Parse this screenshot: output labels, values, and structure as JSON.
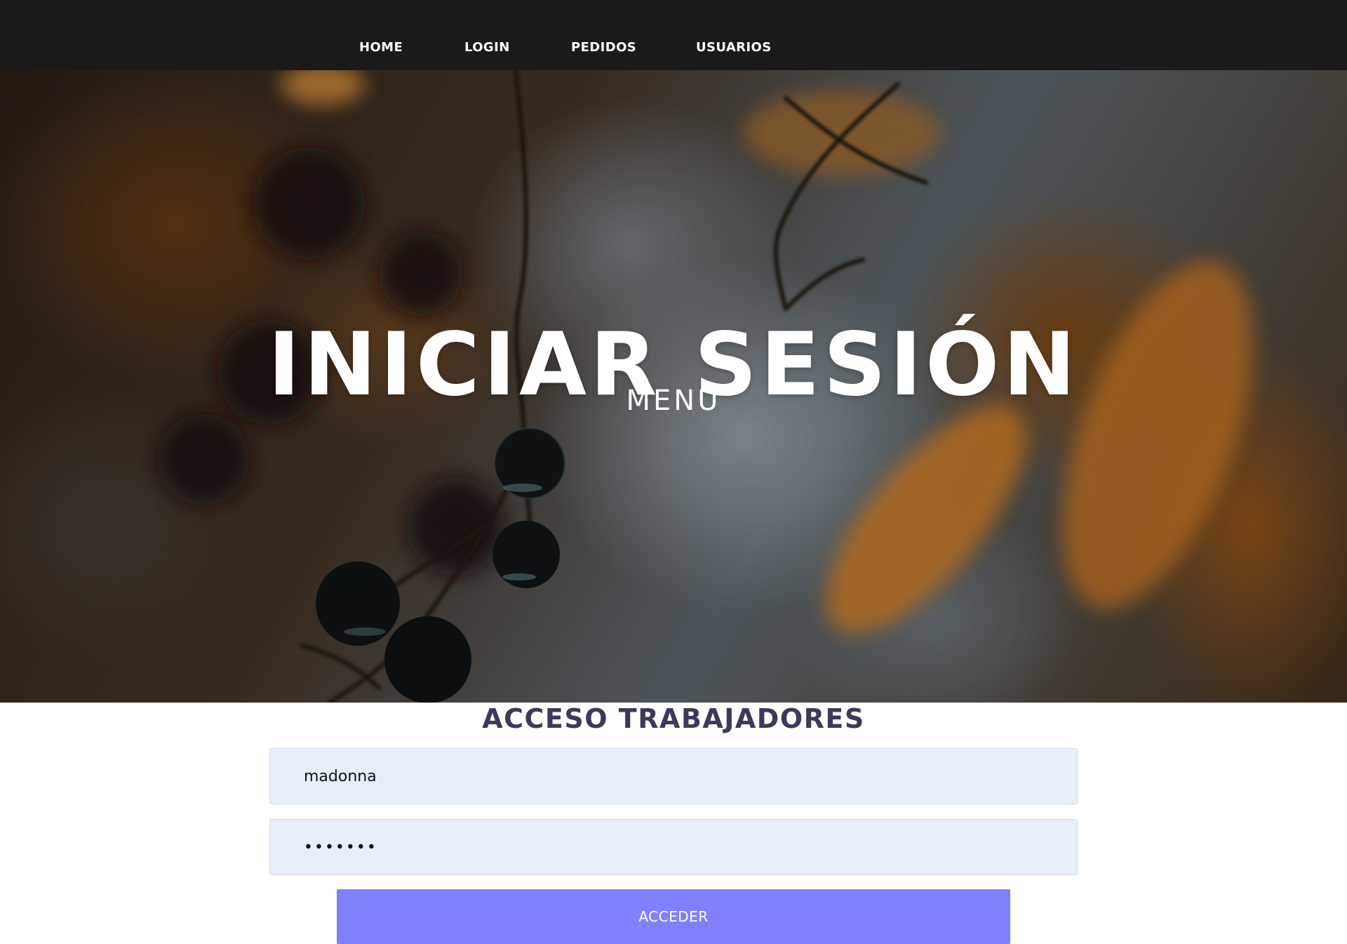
{
  "nav": {
    "items": [
      {
        "label": "HOME"
      },
      {
        "label": "LOGIN"
      },
      {
        "label": "PEDIDOS"
      },
      {
        "label": "USUARIOS"
      }
    ]
  },
  "hero": {
    "title": "INICIAR SESIÓN",
    "subtitle": "MENÚ"
  },
  "login": {
    "heading": "ACCESO TRABAJADORES",
    "username_value": "madonna",
    "password_value": "•••••••",
    "submit_label": "ACCEDER"
  },
  "colors": {
    "navbar_bg": "#1b1a1b",
    "input_bg": "#e8effa",
    "button_bg": "#8180fb",
    "heading_text": "#3b3a5c"
  }
}
